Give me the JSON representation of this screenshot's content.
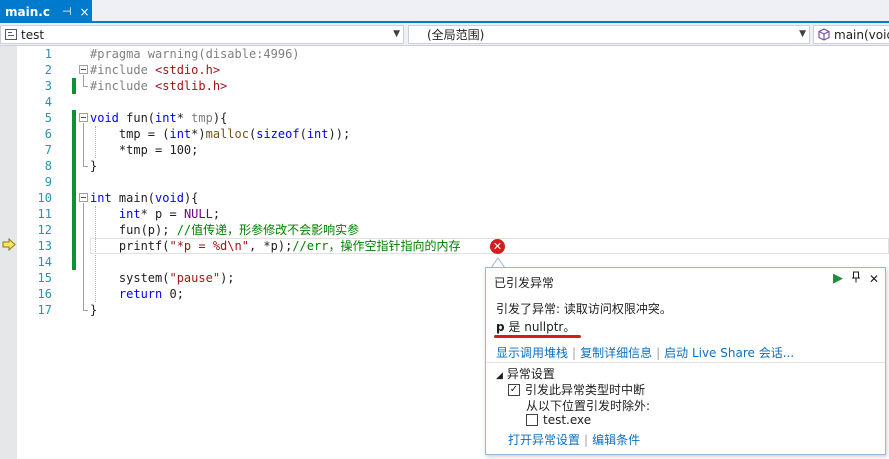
{
  "tab": {
    "filename": "main.c",
    "pin": "⊣",
    "close": "×"
  },
  "navbar": {
    "project": "test",
    "scope": "(全局范围)",
    "member": "main(void)"
  },
  "code": {
    "line_numbers": [
      "1",
      "2",
      "3",
      "4",
      "5",
      "6",
      "7",
      "8",
      "9",
      "10",
      "11",
      "12",
      "13",
      "14",
      "15",
      "16",
      "17"
    ],
    "lines": {
      "l1a": "#pragma warning(disable:4996)",
      "l2a": "#include ",
      "l2b": "<stdio.h>",
      "l3a": "#include ",
      "l3b": "<stdlib.h>",
      "l5a": "void",
      "l5b": " fun(",
      "l5c": "int",
      "l5d": "* ",
      "l5e": "tmp",
      "l5f": "){",
      "l6a": "    tmp = (",
      "l6b": "int",
      "l6c": "*)",
      "l6d": "malloc",
      "l6e": "(",
      "l6f": "sizeof",
      "l6g": "(",
      "l6h": "int",
      "l6i": "));",
      "l7a": "    *tmp = 100;",
      "l8a": "}",
      "l10a": "int",
      "l10b": " main(",
      "l10c": "void",
      "l10d": "){",
      "l11a": "    ",
      "l11b": "int",
      "l11c": "* p = ",
      "l11d": "NULL",
      "l11e": ";",
      "l12a": "    fun(p); ",
      "l12b": "//值传递，形参修改不会影响实参",
      "l13a": "    printf(",
      "l13b": "\"*p = %d\\n\"",
      "l13c": ", *p);",
      "l13d": "//err，操作空指针指向的内存",
      "l15a": "    system(",
      "l15b": "\"pause\"",
      "l15c": ");",
      "l16a": "    ",
      "l16b": "return",
      "l16c": " 0;",
      "l17a": "}"
    }
  },
  "exception": {
    "title": "已引发异常",
    "message": "引发了异常: 读取访问权限冲突。",
    "null_var": "p",
    "null_rest": " 是 nullptr。",
    "links": [
      "显示调用堆栈",
      "复制详细信息",
      "启动 Live Share 会话..."
    ],
    "settings_title": "异常设置",
    "break_checkbox": "引发此异常类型时中断",
    "break_checked": "✓",
    "except_label": "从以下位置引发时除外:",
    "exe_name": "test.exe",
    "bottom_links": [
      "打开异常设置",
      "编辑条件"
    ]
  }
}
